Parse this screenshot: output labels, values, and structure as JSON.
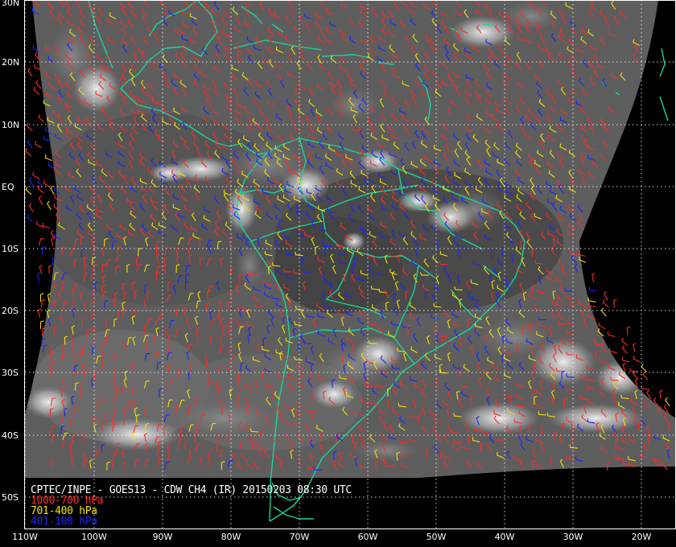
{
  "map": {
    "caption": {
      "title": "CPTEC/INPE - GOES13 - CDW CH4 (IR) 20150203 08:30 UTC",
      "legend": [
        {
          "label": "1000-700 hPa",
          "color": "#ff2a2a"
        },
        {
          "label": "701-400 hPa",
          "color": "#f2e000"
        },
        {
          "label": "401-100 hPa",
          "color": "#1a24ff"
        }
      ]
    },
    "lat_labels": [
      "30N",
      "20N",
      "10N",
      "EQ",
      "10S",
      "20S",
      "30S",
      "40S",
      "50S"
    ],
    "lon_labels": [
      "110W",
      "100W",
      "90W",
      "80W",
      "70W",
      "60W",
      "50W",
      "40W",
      "30W",
      "20W"
    ],
    "colors": {
      "coastline": "#19d49a",
      "grid": "#ffffff",
      "background": "#000000",
      "barb_low": "#ff2a2a",
      "barb_mid": "#f2e000",
      "barb_high": "#1a24ff"
    }
  }
}
